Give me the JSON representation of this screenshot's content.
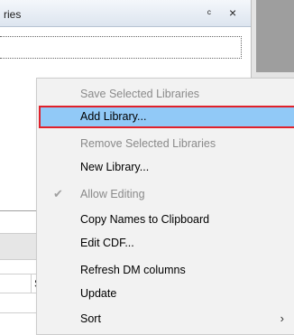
{
  "panel": {
    "title": "ries",
    "pin_glyph": "ͨ",
    "close_glyph": "×",
    "cell_text": "S"
  },
  "menu": {
    "items": [
      {
        "label": "Save Selected Libraries",
        "state": "disabled"
      },
      {
        "label": "Add Library...",
        "state": "selected"
      },
      {
        "label": "Remove Selected Libraries",
        "state": "disabled"
      },
      {
        "label": "New Library...",
        "state": "enabled"
      },
      {
        "label": "Allow Editing",
        "state": "disabled",
        "icon": "check-icon",
        "glyph": "✔"
      },
      {
        "label": "Copy Names to Clipboard",
        "state": "enabled"
      },
      {
        "label": "Edit CDF...",
        "state": "enabled"
      },
      {
        "label": "Refresh DM columns",
        "state": "enabled"
      },
      {
        "label": "Update",
        "state": "enabled"
      },
      {
        "label": "Sort",
        "state": "enabled",
        "icon": "chevron-right-icon",
        "glyph": "›"
      }
    ]
  },
  "colors": {
    "highlight": "#91c9f7",
    "highlight_border": "#e0212b",
    "disabled_text": "#8a8a8a"
  }
}
